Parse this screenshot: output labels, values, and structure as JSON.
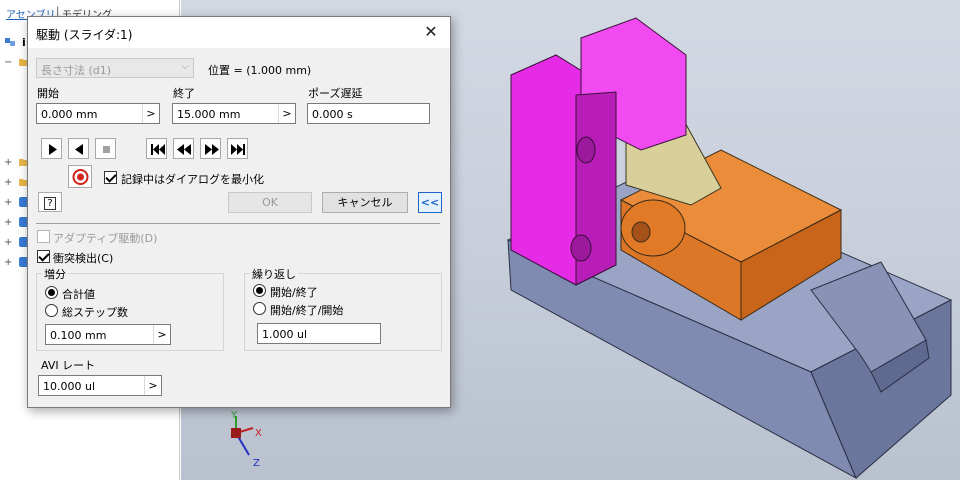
{
  "browser": {
    "tabs": [
      "アセンブリ",
      "モデリング"
    ],
    "root_label": "i"
  },
  "dialog": {
    "title": "駆動 (スライダ:1)",
    "close_glyph": "✕",
    "dimension_combo": {
      "value": "長さ寸法 (d1)",
      "arrow": "⌵"
    },
    "position_text": "位置 = (1.000 mm)",
    "start": {
      "label": "開始",
      "value": "0.000 mm"
    },
    "end": {
      "label": "終了",
      "value": "15.000 mm"
    },
    "pause": {
      "label": "ポーズ遅延",
      "value": "0.000 s"
    },
    "record_minimize": {
      "label": "記録中はダイアログを最小化",
      "checked": true
    },
    "ok_label": "OK",
    "cancel_label": "キャンセル",
    "collapse_label": "<<",
    "help_label": "?",
    "adaptive": {
      "label": "アダプティブ駆動(D)",
      "checked": false,
      "enabled": false
    },
    "collision": {
      "label": "衝突検出(C)",
      "checked": true
    },
    "increment": {
      "title": "増分",
      "options": [
        "合計値",
        "総ステップ数"
      ],
      "selected": 0,
      "value": "0.100 mm"
    },
    "repeat": {
      "title": "繰り返し",
      "options": [
        "開始/終了",
        "開始/終了/開始"
      ],
      "selected": 0,
      "value": "1.000 ul"
    },
    "avi": {
      "label": "AVI レート",
      "value": "10.000 ul"
    },
    "field_button": ">"
  },
  "viewport": {
    "axes": {
      "x": "X",
      "y": "Y",
      "z": "Z"
    },
    "colors": {
      "background": "#c9d0dc",
      "magenta_part": "#e62be6",
      "orange_part": "#e07a26",
      "base_part": "#8b96b8",
      "link_part": "#d8cf9a",
      "record_red": "#d0231b",
      "collapse_blue": "#1c64c8"
    }
  }
}
